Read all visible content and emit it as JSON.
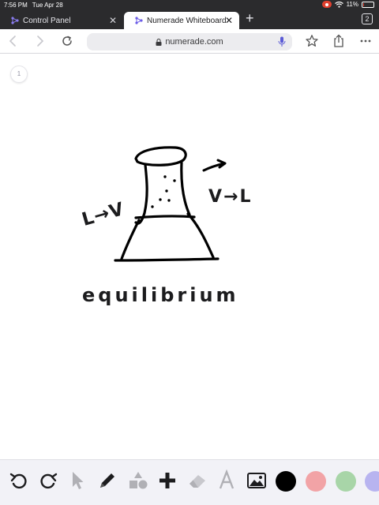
{
  "status_bar": {
    "time": "7:56 PM",
    "date": "Tue Apr 28",
    "battery": "11%",
    "battery_level": 0.11
  },
  "tabs": [
    {
      "title": "Control Panel",
      "active": false
    },
    {
      "title": "Numerade Whiteboard",
      "active": true
    }
  ],
  "tab_count": "2",
  "address_bar": {
    "url": "numerade.com"
  },
  "canvas": {
    "page_number": "1",
    "handwriting": {
      "left_label": "L→V",
      "right_label": "V→L",
      "caption": "equilibrium"
    }
  },
  "colors": {
    "black": "#000000",
    "pink": "#f2a3a6",
    "green": "#a8d5a8",
    "purple": "#b8b4f0",
    "record": "#e0402f"
  },
  "tools": [
    "undo-icon",
    "redo-icon",
    "pointer-icon",
    "pen-icon",
    "shapes-icon",
    "add-icon",
    "eraser-icon",
    "text-icon",
    "image-icon"
  ]
}
